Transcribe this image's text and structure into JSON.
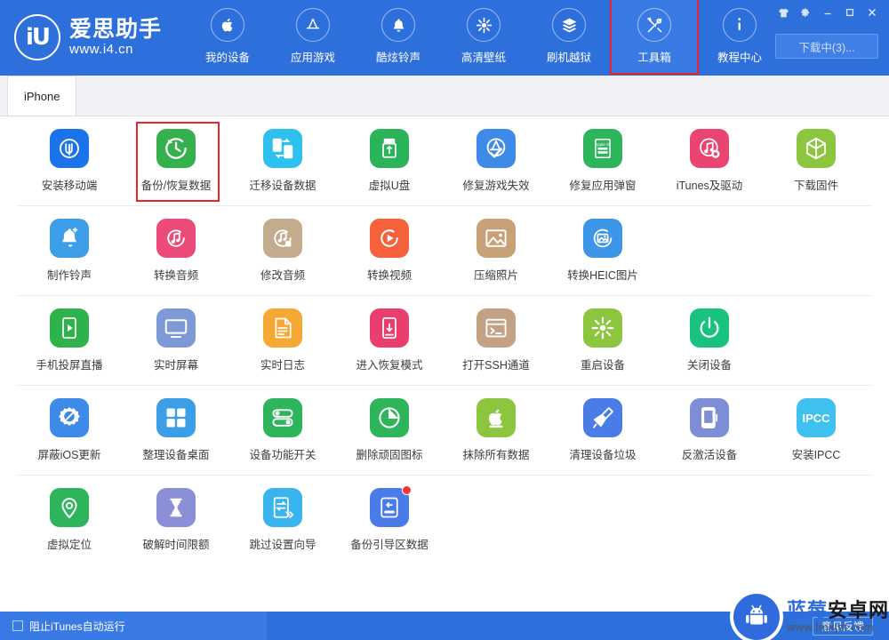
{
  "window": {
    "brand_initials": "iU",
    "brand_name": "爱思助手",
    "brand_url": "www.i4.cn",
    "controls": [
      {
        "name": "skin-icon",
        "label": "皮肤"
      },
      {
        "name": "settings-icon",
        "label": "设置"
      },
      {
        "name": "minimize-icon",
        "label": "最小化"
      },
      {
        "name": "maximize-icon",
        "label": "最大化"
      },
      {
        "name": "close-icon",
        "label": "关闭"
      }
    ],
    "download_button": "下载中(3)..."
  },
  "nav": {
    "items": [
      {
        "label": "我的设备",
        "icon": "apple-icon",
        "active": false,
        "highlight": false
      },
      {
        "label": "应用游戏",
        "icon": "appstore-icon",
        "active": false,
        "highlight": false
      },
      {
        "label": "酷炫铃声",
        "icon": "bell-icon",
        "active": false,
        "highlight": false
      },
      {
        "label": "高清壁纸",
        "icon": "wallpaper-icon",
        "active": false,
        "highlight": false
      },
      {
        "label": "刷机越狱",
        "icon": "flash-icon",
        "active": false,
        "highlight": false
      },
      {
        "label": "工具箱",
        "icon": "tools-icon",
        "active": true,
        "highlight": true
      },
      {
        "label": "教程中心",
        "icon": "info-icon",
        "active": false,
        "highlight": false
      }
    ]
  },
  "tabs": [
    {
      "label": "iPhone",
      "active": true
    }
  ],
  "toolbox": {
    "rows": [
      {
        "items": [
          {
            "label": "安装移动端",
            "icon": "i4-app-icon",
            "color": "#1a73e8",
            "marked": false,
            "badge": false
          },
          {
            "label": "备份/恢复数据",
            "icon": "backup-restore-icon",
            "color": "#34b14c",
            "marked": true,
            "badge": false
          },
          {
            "label": "迁移设备数据",
            "icon": "migrate-device-icon",
            "color": "#2ec1f0",
            "marked": false,
            "badge": false
          },
          {
            "label": "虚拟U盘",
            "icon": "usb-drive-icon",
            "color": "#2bb35a",
            "marked": false,
            "badge": false
          },
          {
            "label": "修复游戏失效",
            "icon": "appstore-fix-icon",
            "color": "#3d8ae8",
            "marked": false,
            "badge": false
          },
          {
            "label": "修复应用弹窗",
            "icon": "appleid-popup-icon",
            "color": "#2eb55c",
            "marked": false,
            "badge": false
          },
          {
            "label": "iTunes及驱动",
            "icon": "itunes-driver-icon",
            "color": "#ea4470",
            "marked": false,
            "badge": false
          },
          {
            "label": "下载固件",
            "icon": "firmware-box-icon",
            "color": "#8cc63f",
            "marked": false,
            "badge": false
          }
        ]
      },
      {
        "items": [
          {
            "label": "制作铃声",
            "icon": "make-ringtone-icon",
            "color": "#3d9ee8",
            "marked": false,
            "badge": false
          },
          {
            "label": "转换音频",
            "icon": "convert-audio-icon",
            "color": "#ec4a79",
            "marked": false,
            "badge": false
          },
          {
            "label": "修改音频",
            "icon": "edit-audio-icon",
            "color": "#c3ab8e",
            "marked": false,
            "badge": false
          },
          {
            "label": "转换视频",
            "icon": "convert-video-icon",
            "color": "#f4613a",
            "marked": false,
            "badge": false
          },
          {
            "label": "压缩照片",
            "icon": "compress-photo-icon",
            "color": "#c9a178",
            "marked": false,
            "badge": false
          },
          {
            "label": "转换HEIC图片",
            "icon": "convert-heic-icon",
            "color": "#3d95e8",
            "marked": false,
            "badge": false
          }
        ]
      },
      {
        "items": [
          {
            "label": "手机投屏直播",
            "icon": "screen-cast-icon",
            "color": "#2eb24c",
            "marked": false,
            "badge": false
          },
          {
            "label": "实时屏幕",
            "icon": "realtime-screen-icon",
            "color": "#7d9ad6",
            "marked": false,
            "badge": false
          },
          {
            "label": "实时日志",
            "icon": "realtime-log-icon",
            "color": "#f5a833",
            "marked": false,
            "badge": false
          },
          {
            "label": "进入恢复模式",
            "icon": "recovery-mode-icon",
            "color": "#ea3f6e",
            "marked": false,
            "badge": false
          },
          {
            "label": "打开SSH通道",
            "icon": "ssh-terminal-icon",
            "color": "#c3a184",
            "marked": false,
            "badge": false
          },
          {
            "label": "重启设备",
            "icon": "restart-device-icon",
            "color": "#8cc63f",
            "marked": false,
            "badge": false
          },
          {
            "label": "关闭设备",
            "icon": "power-off-icon",
            "color": "#19c37d",
            "marked": false,
            "badge": false
          }
        ]
      },
      {
        "items": [
          {
            "label": "屏蔽iOS更新",
            "icon": "block-ios-update-icon",
            "color": "#3d8ae8",
            "marked": false,
            "badge": false
          },
          {
            "label": "整理设备桌面",
            "icon": "organize-desktop-icon",
            "color": "#3d9ee8",
            "marked": false,
            "badge": false
          },
          {
            "label": "设备功能开关",
            "icon": "feature-toggle-icon",
            "color": "#2eb55c",
            "marked": false,
            "badge": false
          },
          {
            "label": "删除顽固图标",
            "icon": "delete-icon-icon",
            "color": "#2eb55c",
            "marked": false,
            "badge": false
          },
          {
            "label": "抹除所有数据",
            "icon": "erase-data-icon",
            "color": "#8cc63f",
            "marked": false,
            "badge": false
          },
          {
            "label": "清理设备垃圾",
            "icon": "clean-junk-icon",
            "color": "#4a7ce8",
            "marked": false,
            "badge": false
          },
          {
            "label": "反激活设备",
            "icon": "deactivate-icon",
            "color": "#7d8ed6",
            "marked": false,
            "badge": false
          },
          {
            "label": "安装IPCC",
            "icon": "ipcc-icon",
            "color": "#3ec1ef",
            "marked": false,
            "badge": false,
            "text": "IPCC"
          }
        ]
      },
      {
        "items": [
          {
            "label": "虚拟定位",
            "icon": "virtual-location-icon",
            "color": "#2eb55c",
            "marked": false,
            "badge": false
          },
          {
            "label": "破解时间限额",
            "icon": "time-limit-icon",
            "color": "#8a8fd8",
            "marked": false,
            "badge": false
          },
          {
            "label": "跳过设置向导",
            "icon": "skip-setup-icon",
            "color": "#3ab4ef",
            "marked": false,
            "badge": false
          },
          {
            "label": "备份引导区数据",
            "icon": "backup-boot-icon",
            "color": "#4a7ce8",
            "marked": false,
            "badge": true
          }
        ]
      }
    ]
  },
  "statusbar": {
    "block_itunes_label": "阻止iTunes自动运行",
    "block_itunes_checked": false,
    "feedback_label": "意见反馈"
  },
  "watermark": {
    "title_blue": "蓝莓",
    "title_dark": "安卓网",
    "url": "www.lmkjst.com"
  }
}
